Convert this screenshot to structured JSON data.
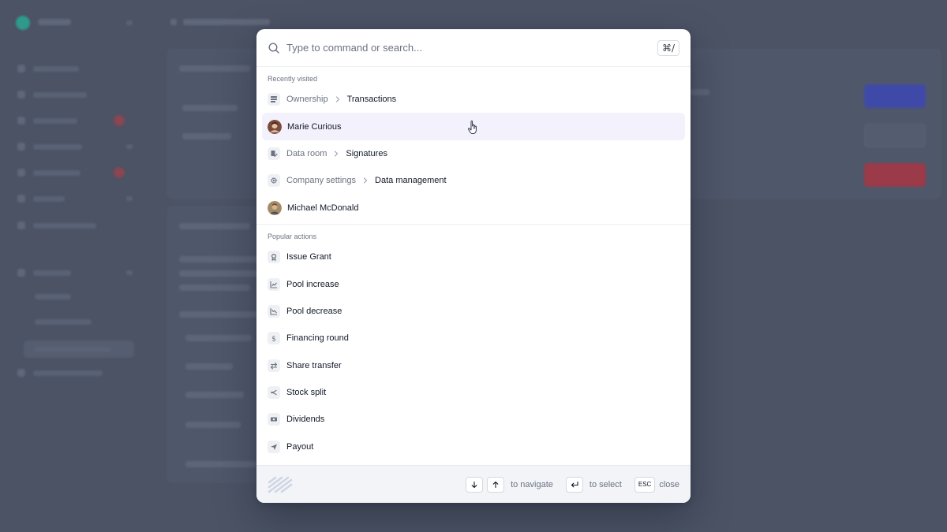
{
  "search": {
    "placeholder": "Type to command or search...",
    "shortcut": "⌘/"
  },
  "recent": {
    "label": "Recently visited",
    "items": [
      {
        "type": "crumb",
        "icon": "table-icon",
        "parent": "Ownership",
        "child": "Transactions"
      },
      {
        "type": "person",
        "avatar": "avatar-marie",
        "name": "Marie Curious",
        "active": true
      },
      {
        "type": "crumb",
        "icon": "document-sign-icon",
        "parent": "Data room",
        "child": "Signatures"
      },
      {
        "type": "crumb",
        "icon": "gear-icon",
        "parent": "Company settings",
        "child": "Data management"
      },
      {
        "type": "person",
        "avatar": "avatar-michael",
        "name": "Michael McDonald"
      }
    ]
  },
  "popular": {
    "label": "Popular actions",
    "items": [
      {
        "icon": "award-icon",
        "label": "Issue Grant"
      },
      {
        "icon": "chart-up-icon",
        "label": "Pool increase"
      },
      {
        "icon": "chart-down-icon",
        "label": "Pool decrease"
      },
      {
        "icon": "dollar-icon",
        "label": "Financing round"
      },
      {
        "icon": "transfer-icon",
        "label": "Share transfer"
      },
      {
        "icon": "split-icon",
        "label": "Stock split"
      },
      {
        "icon": "banknote-icon",
        "label": "Dividends"
      },
      {
        "icon": "send-icon",
        "label": "Payout"
      }
    ]
  },
  "footer": {
    "navigate_hint": "to navigate",
    "select_hint": "to select",
    "esc_key": "ESC",
    "close_hint": "close"
  },
  "colors": {
    "overlay": "#4b5365",
    "active_row": "#f3f1fb",
    "bg_primary_button": "#3f4aa8",
    "bg_danger_button": "#9b3a48"
  }
}
